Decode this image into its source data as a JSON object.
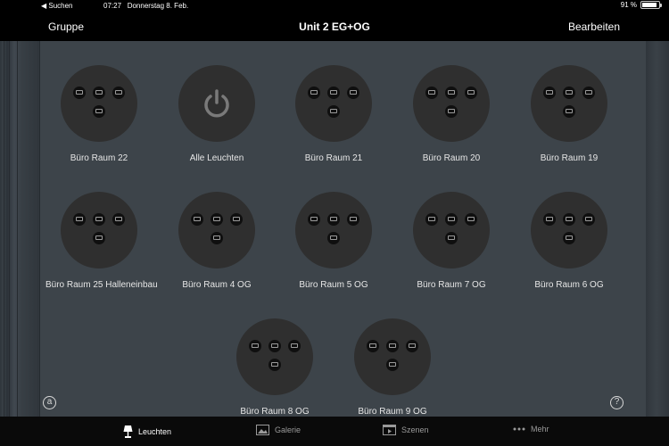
{
  "status_bar": {
    "back": "◀ Suchen",
    "time": "07:27",
    "date": "Donnerstag 8. Feb.",
    "battery": "91 %",
    "battery_level": 0.91
  },
  "nav": {
    "left": "Gruppe",
    "title": "Unit 2 EG+OG",
    "right": "Bearbeiten"
  },
  "tiles": [
    {
      "label": "Büro Raum 22",
      "icon": "lights-icon"
    },
    {
      "label": "Alle Leuchten",
      "icon": "power-icon"
    },
    {
      "label": "Büro Raum 21",
      "icon": "lights-icon"
    },
    {
      "label": "Büro Raum 20",
      "icon": "lights-icon"
    },
    {
      "label": "Büro Raum 19",
      "icon": "lights-icon"
    },
    {
      "label": "Büro Raum 25 Halleneinbau",
      "icon": "lights-icon"
    },
    {
      "label": "Büro Raum 4 OG",
      "icon": "lights-icon"
    },
    {
      "label": "Büro Raum 5 OG",
      "icon": "lights-icon"
    },
    {
      "label": "Büro Raum 7 OG",
      "icon": "lights-icon"
    },
    {
      "label": "Büro Raum 6 OG",
      "icon": "lights-icon"
    },
    {
      "label": "Büro Raum 8 OG",
      "icon": "lights-icon"
    },
    {
      "label": "Büro Raum 9 OG",
      "icon": "lights-icon"
    }
  ],
  "corner": {
    "left": "a",
    "right": "?"
  },
  "tabs": [
    {
      "label": "Leuchten",
      "icon": "lamp-icon",
      "active": true
    },
    {
      "label": "Galerie",
      "icon": "gallery-icon",
      "active": false
    },
    {
      "label": "Szenen",
      "icon": "scenes-icon",
      "active": false
    },
    {
      "label": "Mehr",
      "icon": "more-icon",
      "active": false
    }
  ]
}
